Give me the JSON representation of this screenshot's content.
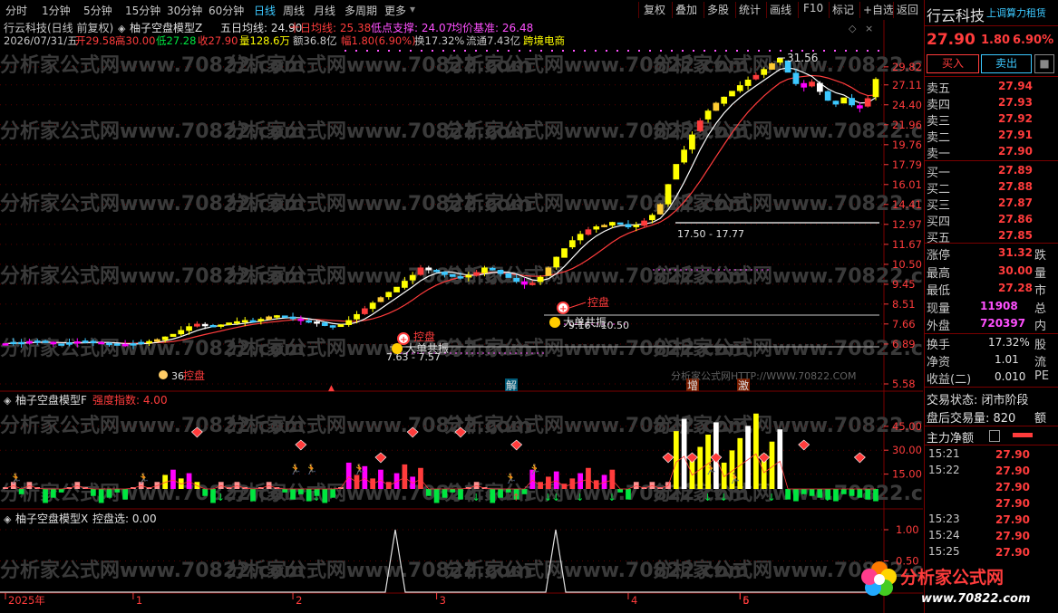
{
  "topbar": {
    "periods": [
      "分时",
      "1分钟",
      "5分钟",
      "15分钟",
      "30分钟",
      "60分钟",
      "日线",
      "周线",
      "月线",
      "多周期",
      "更多"
    ],
    "active_period": "日线",
    "tools": [
      "复权",
      "叠加",
      "多股",
      "统计",
      "画线",
      "F10",
      "标记",
      "+自选",
      "返回"
    ]
  },
  "main_pane": {
    "title": "行云科技(日线 前复权)",
    "indicator_name": "柚子空盘模型Z",
    "ma5_label": "五日均线: 24.90",
    "ma10_label": "十日均线: 25.38",
    "low_support_label": "低点支撑: 24.07",
    "avg_base_label": "均价基准: 26.48",
    "info_date": "2026/07/31/五",
    "info_open": "开29.58",
    "info_high": "高30.00",
    "info_low": "低27.28",
    "info_close": "收27.90",
    "info_volume": "量128.6万",
    "info_amount": "额36.8亿",
    "info_change": "幅1.80(6.90%)",
    "info_turnover": "换17.32%",
    "info_float": "流通7.43亿",
    "info_concept": "跨境电商",
    "price_ticks": [
      "29.82",
      "27.11",
      "24.40",
      "21.96",
      "19.76",
      "17.79",
      "16.01",
      "14.41",
      "12.97",
      "11.67",
      "10.50",
      "9.45",
      "8.51",
      "7.66",
      "6.89",
      "5.58"
    ],
    "annotations": {
      "max_price": "31.56",
      "range_1": "17.50 - 17.77",
      "range_2": "9.16 - 10.50",
      "range_3": "7.63 - 7.57",
      "low_label": "36",
      "kongpan_1": "控盘",
      "kongpan_2": "控盘",
      "kongpan_3": "控盘",
      "big_order_1": "大单共振",
      "big_order_2": "大单共振",
      "site_label": "分析家公式网HTTP://WWW.70822.COM",
      "tag_jie": "解",
      "tag_zeng": "增",
      "tag_ji": "激"
    }
  },
  "sub_pane_1": {
    "indicator_name": "柚子空盘模型F",
    "strength_label": "强度指数: 4.00",
    "ticks": [
      "45.00",
      "30.00",
      "15.00"
    ]
  },
  "sub_pane_2": {
    "indicator_name": "柚子空盘模型X",
    "kongpan_label": "控盘选: 0.00",
    "ticks": [
      "1.00",
      "0.50"
    ]
  },
  "time_axis": [
    "2025年",
    "1",
    "2",
    "3",
    "4",
    "5",
    "6"
  ],
  "watermark_text": "分析家公式网www.70822.com",
  "right_panel": {
    "stock_name": "行云科技",
    "marquee": "上调算力租赁",
    "price": "27.90",
    "change": "1.80",
    "change_pct": "6.90%",
    "buy_btn": "买入",
    "sell_btn": "卖出",
    "more_btn": "■",
    "sells": [
      {
        "label": "卖五",
        "price": "27.94"
      },
      {
        "label": "卖四",
        "price": "27.93"
      },
      {
        "label": "卖三",
        "price": "27.92"
      },
      {
        "label": "卖二",
        "price": "27.91"
      },
      {
        "label": "卖一",
        "price": "27.90"
      }
    ],
    "buys": [
      {
        "label": "买一",
        "price": "27.89"
      },
      {
        "label": "买二",
        "price": "27.88"
      },
      {
        "label": "买三",
        "price": "27.87"
      },
      {
        "label": "买四",
        "price": "27.86"
      },
      {
        "label": "买五",
        "price": "27.85"
      }
    ],
    "stats": [
      {
        "label": "涨停",
        "value": "31.32",
        "tail": "跌"
      },
      {
        "label": "最高",
        "value": "30.00",
        "tail": "量"
      },
      {
        "label": "最低",
        "value": "27.28",
        "tail": "市"
      },
      {
        "label": "现量",
        "value": "11908",
        "tail": "总"
      },
      {
        "label": "外盘",
        "value": "720397",
        "tail": "内"
      }
    ],
    "stats2": [
      {
        "label": "换手",
        "value": "17.32%",
        "tail": "股"
      },
      {
        "label": "净资",
        "value": "1.01",
        "tail": "流"
      },
      {
        "label": "收益(二)",
        "value": "0.010",
        "tail": "PE"
      }
    ],
    "trade_status": "交易状态: 闭市阶段",
    "after_hours": "盘后交易量: 820",
    "after_tail": "额",
    "main_flow": "主力净额",
    "ticks": [
      {
        "time": "15:21",
        "price": "27.90"
      },
      {
        "time": "15:22",
        "price": "27.90"
      },
      {
        "time": "",
        "price": "27.90"
      },
      {
        "time": "",
        "price": "27.90"
      },
      {
        "time": "15:23",
        "price": "27.90"
      },
      {
        "time": "15:24",
        "price": "27.90"
      },
      {
        "time": "15:25",
        "price": "27.90"
      }
    ],
    "logo_text": "分析家公式网",
    "logo_url": "www.70822.com"
  },
  "chart_data": {
    "type": "candlestick",
    "closes": [
      6.9,
      6.95,
      6.92,
      6.98,
      7.0,
      6.96,
      6.9,
      6.88,
      6.93,
      6.97,
      7.0,
      6.95,
      6.92,
      6.9,
      6.88,
      6.86,
      6.9,
      6.95,
      6.98,
      7.05,
      7.15,
      7.25,
      7.4,
      7.55,
      7.65,
      7.6,
      7.58,
      7.62,
      7.7,
      7.75,
      7.8,
      7.78,
      7.85,
      7.95,
      8.0,
      7.95,
      7.88,
      7.8,
      7.75,
      7.7,
      7.6,
      7.55,
      7.63,
      7.8,
      8.05,
      8.3,
      8.55,
      8.8,
      9.05,
      9.3,
      9.6,
      9.9,
      10.3,
      10.2,
      10.1,
      9.95,
      9.85,
      9.8,
      9.9,
      10.05,
      10.3,
      10.2,
      10.0,
      9.8,
      9.6,
      9.45,
      9.5,
      9.8,
      10.3,
      10.9,
      11.4,
      11.9,
      12.3,
      12.6,
      12.8,
      12.9,
      13.1,
      13.0,
      12.8,
      12.9,
      13.2,
      13.6,
      14.4,
      16.0,
      17.8,
      19.2,
      20.8,
      22.4,
      23.6,
      24.6,
      25.4,
      26.2,
      27.0,
      27.8,
      28.5,
      29.4,
      30.3,
      31.2,
      29.0,
      27.3,
      26.8,
      27.5,
      26.2,
      25.0,
      24.5,
      25.3,
      24.4,
      24.0,
      25.2,
      27.9
    ],
    "ma5": [
      24.9
    ],
    "ma10": [
      25.38
    ],
    "strength": [
      4.0
    ],
    "y_scale": "log",
    "ylim": [
      5.58,
      31.56
    ]
  }
}
